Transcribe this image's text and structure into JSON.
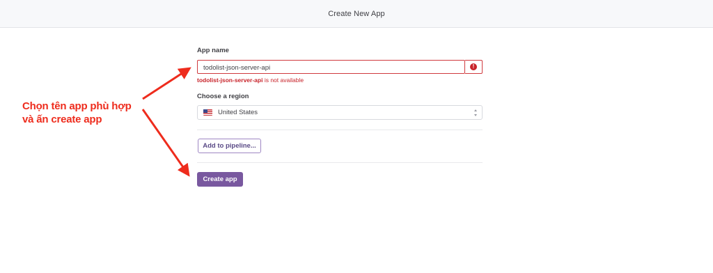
{
  "header": {
    "title": "Create New App"
  },
  "form": {
    "app_name_label": "App name",
    "app_name_value": "todolist-json-server-api",
    "error_icon": "exclamation-icon",
    "error_icon_glyph": "!",
    "error_name": "todolist-json-server-api",
    "error_suffix": " is not available",
    "region_label": "Choose a region",
    "region_value": "United States",
    "region_flag": "us-flag-icon",
    "pipeline_button": "Add to pipeline...",
    "create_button": "Create app"
  },
  "annotation": {
    "line1": "Chọn tên app phù hợp",
    "line2": "và ấn create app",
    "color": "#ee2c1d"
  },
  "colors": {
    "error": "#c8232a",
    "primary": "#79589f",
    "header_bg": "#f7f8fa"
  }
}
